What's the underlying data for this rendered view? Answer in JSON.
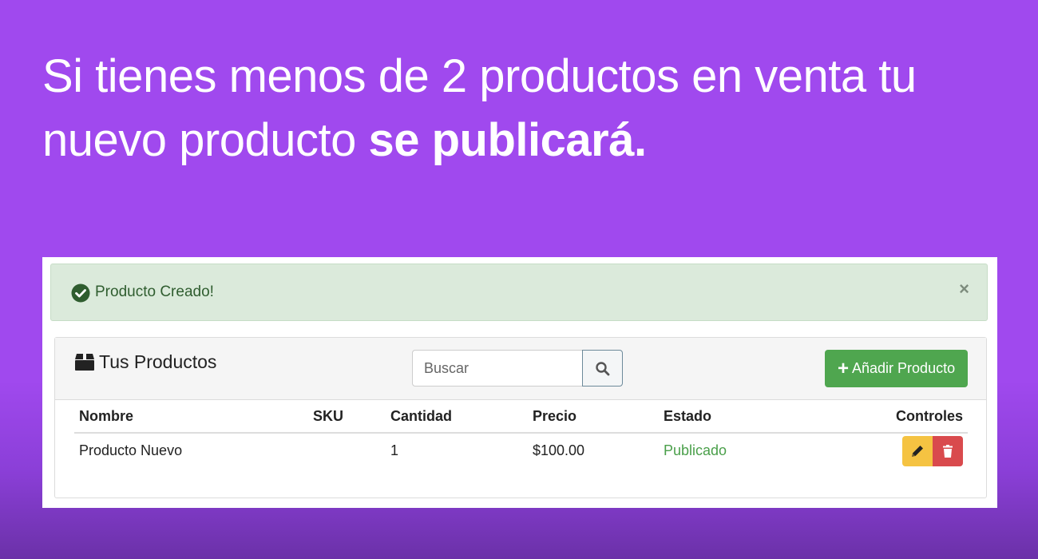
{
  "headline": {
    "normal": "Si tienes menos de 2 productos en venta tu nuevo producto ",
    "bold": "se publicará."
  },
  "alert": {
    "message": "Producto Creado!",
    "close": "×",
    "icon": "check-circle-icon",
    "color": "#dbeadb"
  },
  "panel": {
    "title": "Tus Productos",
    "icon": "box-icon"
  },
  "search": {
    "placeholder": "Buscar",
    "icon": "search-icon"
  },
  "add_button": {
    "label": "Añadir Producto",
    "icon": "plus-icon",
    "color": "#4fa64f"
  },
  "table": {
    "columns": [
      "Nombre",
      "SKU",
      "Cantidad",
      "Precio",
      "Estado",
      "Controles"
    ],
    "rows": [
      {
        "nombre": "Producto Nuevo",
        "sku": "",
        "cantidad": "1",
        "precio": "$100.00",
        "estado": "Publicado"
      }
    ]
  },
  "controls": {
    "edit_icon": "pencil-icon",
    "delete_icon": "trash-icon",
    "edit_color": "#f5c342",
    "delete_color": "#d94a4d"
  },
  "colors": {
    "background": "#a049ee",
    "status_published": "#4a9f4a"
  }
}
